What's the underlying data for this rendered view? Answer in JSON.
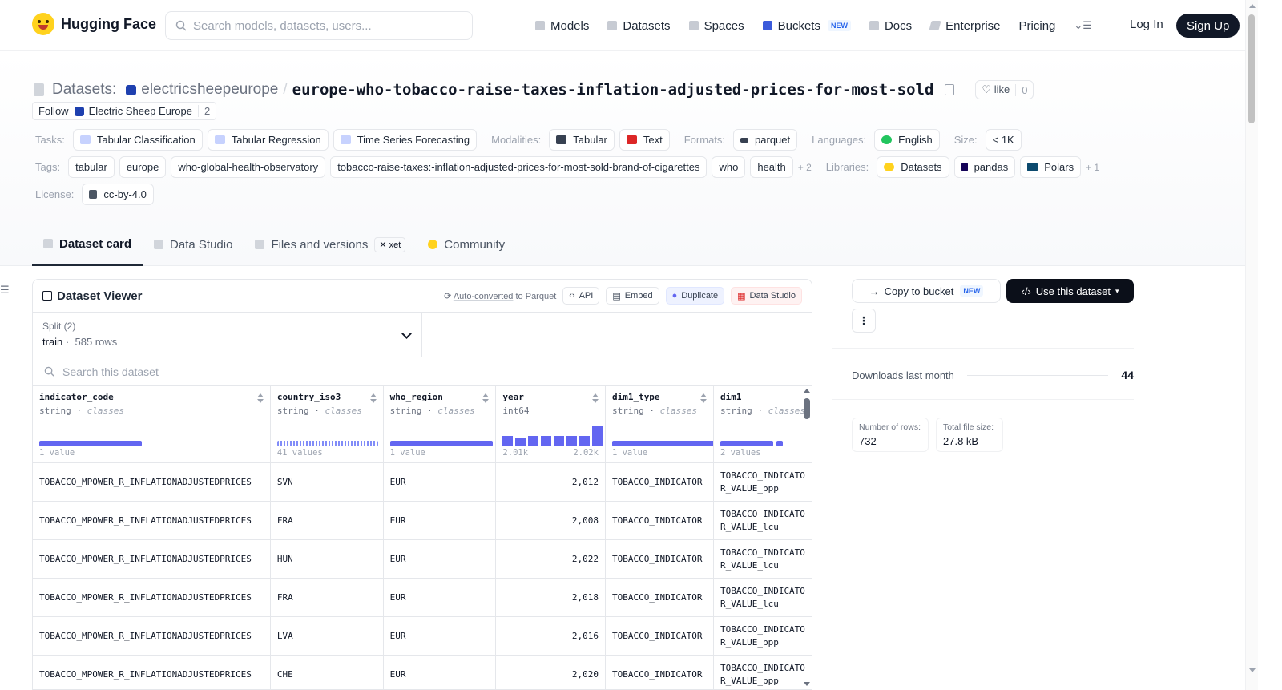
{
  "nav": {
    "brand": "Hugging Face",
    "search_placeholder": "Search models, datasets, users...",
    "links": [
      {
        "label": "Models",
        "icon": "cube-icon"
      },
      {
        "label": "Datasets",
        "icon": "database-icon"
      },
      {
        "label": "Spaces",
        "icon": "grid-icon"
      },
      {
        "label": "Buckets",
        "icon": "bucket-icon",
        "badge": "NEW"
      },
      {
        "label": "Docs",
        "icon": "book-icon"
      },
      {
        "label": "Enterprise",
        "icon": "building-icon"
      },
      {
        "label": "Pricing"
      }
    ],
    "login": "Log In",
    "signup": "Sign Up"
  },
  "header": {
    "datasets_label": "Datasets:",
    "org": "electricsheepeurope",
    "repo": "europe-who-tobacco-raise-taxes-inflation-adjusted-prices-for-most-sold",
    "like_label": "like",
    "like_count": "0",
    "follow_label": "Follow",
    "follow_org": "Electric Sheep Europe",
    "follow_count": "2",
    "tasks_label": "Tasks:",
    "tasks": [
      "Tabular Classification",
      "Tabular Regression",
      "Time Series Forecasting"
    ],
    "modalities_label": "Modalities:",
    "modalities": [
      "Tabular",
      "Text"
    ],
    "formats_label": "Formats:",
    "formats": [
      "parquet"
    ],
    "languages_label": "Languages:",
    "languages": [
      "English"
    ],
    "size_label": "Size:",
    "size": "< 1K",
    "tags_label": "Tags:",
    "tags": [
      "tabular",
      "europe",
      "who-global-health-observatory",
      "tobacco-raise-taxes:-inflation-adjusted-prices-for-most-sold-brand-of-cigarettes",
      "who",
      "health"
    ],
    "tags_more": "+ 2",
    "libraries_label": "Libraries:",
    "libraries": [
      "Datasets",
      "pandas",
      "Polars"
    ],
    "libraries_more": "+ 1",
    "license_label": "License:",
    "license": "cc-by-4.0",
    "tabs": [
      "Dataset card",
      "Data Studio",
      "Files and versions",
      "Community"
    ],
    "xet_badge": "xet"
  },
  "viewer": {
    "title": "Dataset Viewer",
    "auto_converted": "Auto-converted",
    "to_parquet": "to Parquet",
    "api": "API",
    "embed": "Embed",
    "duplicate": "Duplicate",
    "data_studio": "Data Studio",
    "split_label": "Split (2)",
    "split_name": "train",
    "split_rows": "585 rows",
    "search_placeholder": "Search this dataset",
    "columns": [
      {
        "name": "indicator_code",
        "type": "string",
        "kind": "classes",
        "stat": "1 value"
      },
      {
        "name": "country_iso3",
        "type": "string",
        "kind": "classes",
        "stat": "41 values"
      },
      {
        "name": "who_region",
        "type": "string",
        "kind": "classes",
        "stat": "1 value"
      },
      {
        "name": "year",
        "type": "int64",
        "kind": "",
        "min": "2.01k",
        "max": "2.02k"
      },
      {
        "name": "dim1_type",
        "type": "string",
        "kind": "classes",
        "stat": "1 value"
      },
      {
        "name": "dim1",
        "type": "string",
        "kind": "classes",
        "stat": "2 values"
      }
    ],
    "rows": [
      [
        "TOBACCO_MPOWER_R_INFLATIONADJUSTEDPRICES",
        "SVN",
        "EUR",
        "2,012",
        "TOBACCO_INDICATOR",
        "TOBACCO_INDICATOR_VALUE_ppp"
      ],
      [
        "TOBACCO_MPOWER_R_INFLATIONADJUSTEDPRICES",
        "FRA",
        "EUR",
        "2,008",
        "TOBACCO_INDICATOR",
        "TOBACCO_INDICATOR_VALUE_lcu"
      ],
      [
        "TOBACCO_MPOWER_R_INFLATIONADJUSTEDPRICES",
        "HUN",
        "EUR",
        "2,022",
        "TOBACCO_INDICATOR",
        "TOBACCO_INDICATOR_VALUE_lcu"
      ],
      [
        "TOBACCO_MPOWER_R_INFLATIONADJUSTEDPRICES",
        "FRA",
        "EUR",
        "2,018",
        "TOBACCO_INDICATOR",
        "TOBACCO_INDICATOR_VALUE_lcu"
      ],
      [
        "TOBACCO_MPOWER_R_INFLATIONADJUSTEDPRICES",
        "LVA",
        "EUR",
        "2,016",
        "TOBACCO_INDICATOR",
        "TOBACCO_INDICATOR_VALUE_ppp"
      ],
      [
        "TOBACCO_MPOWER_R_INFLATIONADJUSTEDPRICES",
        "CHE",
        "EUR",
        "2,020",
        "TOBACCO_INDICATOR",
        "TOBACCO_INDICATOR_VALUE_ppp"
      ]
    ]
  },
  "sidebar": {
    "copy_to_bucket": "Copy to bucket",
    "copy_badge": "NEW",
    "use_dataset": "Use this dataset",
    "downloads_label": "Downloads last month",
    "downloads": "44",
    "rows_label": "Number of rows:",
    "rows_value": "732",
    "size_label": "Total file size:",
    "size_value": "27.8 kB"
  },
  "colors": {
    "accent": "#6366f1",
    "dark": "#111827",
    "brand": "#ffd21e"
  }
}
